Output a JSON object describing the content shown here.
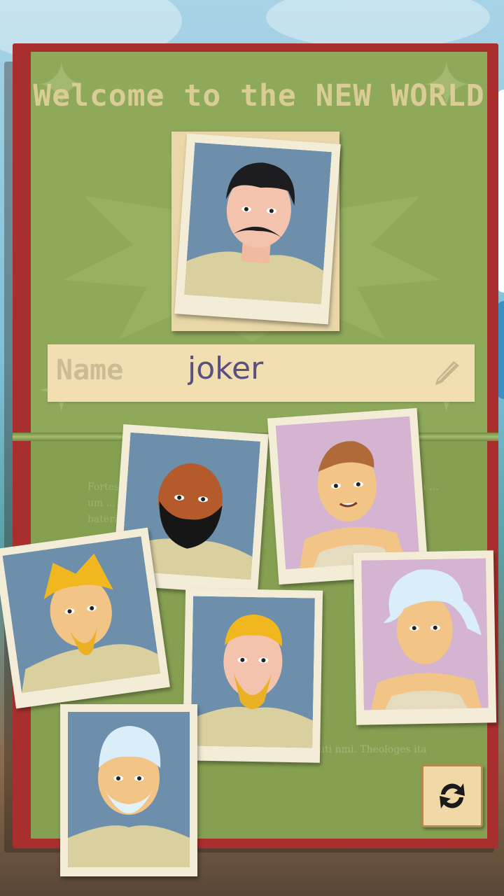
{
  "screen": {
    "title": "Welcome to the NEW WORLD"
  },
  "name_field": {
    "label": "Name",
    "value": "joker",
    "edit_icon": "pen-icon"
  },
  "lore": {
    "text": "Fortes ... loque ... natu ... um ... um ... um ... tum ... um ... tum ... um ... um ... um ... um ... nanum ... Praecis ... dicunt ... um ... haustum ... bateris ...",
    "footer": "uti nmi. Theologes ita"
  },
  "portraits": {
    "selected": "portrait-mustache-man",
    "options": [
      "portrait-bald-bearded-man",
      "portrait-red-haired-woman",
      "portrait-blonde-wild-hair-man",
      "portrait-blonde-bearded-man",
      "portrait-white-haired-woman",
      "portrait-white-bearded-elder"
    ]
  },
  "actions": {
    "refresh_icon": "refresh-icon"
  },
  "colors": {
    "book_cover": "#a82f2e",
    "page_green": "#8fa95a",
    "photo_blue": "#6e8fab",
    "photo_pink": "#d4b4d0",
    "name_text": "#5b4f7f"
  }
}
